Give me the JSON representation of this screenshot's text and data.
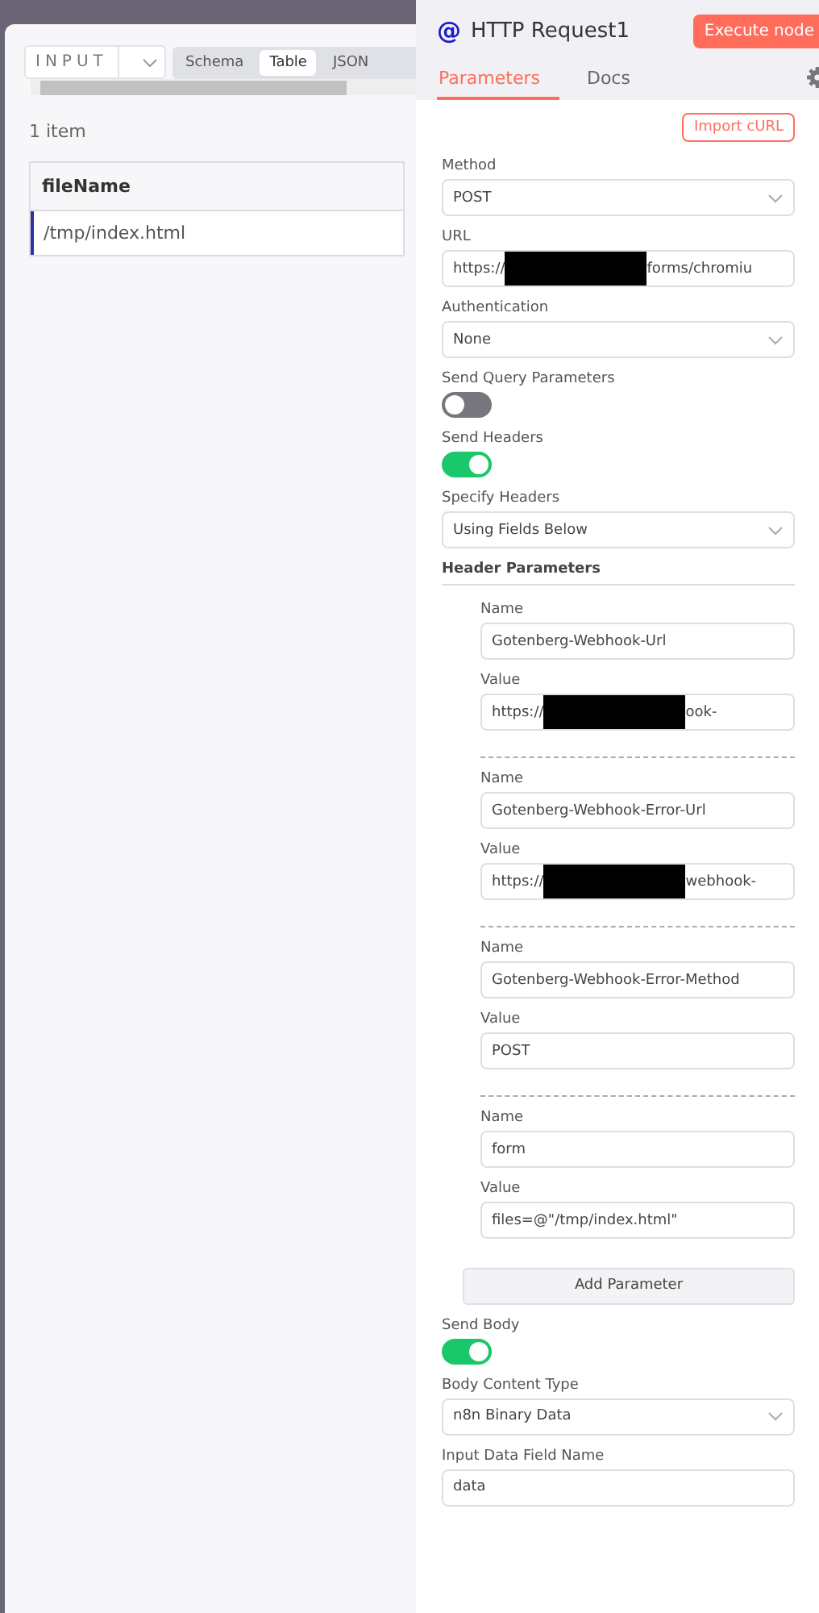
{
  "input_panel": {
    "selector": "INPUT",
    "view_tabs": [
      {
        "label": "Schema",
        "selected": false
      },
      {
        "label": "Table",
        "selected": true
      },
      {
        "label": "JSON",
        "selected": false
      }
    ],
    "item_count": "1 item",
    "table": {
      "columns": [
        "fileName"
      ],
      "rows": [
        [
          "/tmp/index.html"
        ]
      ]
    }
  },
  "node_panel": {
    "icon": "@",
    "title": "HTTP Request1",
    "execute_button": "Execute node",
    "tabs": [
      {
        "label": "Parameters",
        "selected": true
      },
      {
        "label": "Docs",
        "selected": false
      }
    ],
    "import_button": "Import cURL",
    "parameters": [
      {
        "kind": "select",
        "label": "Method",
        "value": "POST"
      },
      {
        "kind": "input",
        "label": "URL",
        "value": "https://",
        "redacted": true,
        "value_end": "forms/chromiu"
      },
      {
        "kind": "select",
        "label": "Authentication",
        "value": "None"
      },
      {
        "kind": "toggle",
        "label": "Send Query Parameters",
        "on": false
      },
      {
        "kind": "toggle",
        "label": "Send Headers",
        "on": true
      },
      {
        "kind": "select",
        "label": "Specify Headers",
        "value": "Using Fields Below"
      },
      {
        "kind": "collection",
        "label": "Header Parameters",
        "add_button": "Add Parameter",
        "items": [
          {
            "name_label": "Name",
            "name": "Gotenberg-Webhook-Url",
            "value_label": "Value",
            "value": "https://",
            "redacted": true,
            "value_end": "ook-"
          },
          {
            "name_label": "Name",
            "name": "Gotenberg-Webhook-Error-Url",
            "value_label": "Value",
            "value": "https://",
            "redacted": true,
            "value_end": "webhook-"
          },
          {
            "name_label": "Name",
            "name": "Gotenberg-Webhook-Error-Method",
            "value_label": "Value",
            "value": "POST",
            "redacted": false
          },
          {
            "name_label": "Name",
            "name": "form",
            "value_label": "Value",
            "value": "files=@\"/tmp/index.html\"",
            "redacted": false
          }
        ]
      },
      {
        "kind": "toggle",
        "label": "Send Body",
        "on": true
      },
      {
        "kind": "select",
        "label": "Body Content Type",
        "value": "n8n Binary Data"
      },
      {
        "kind": "input",
        "label": "Input Data Field Name",
        "value": "data",
        "redacted": false
      }
    ]
  }
}
